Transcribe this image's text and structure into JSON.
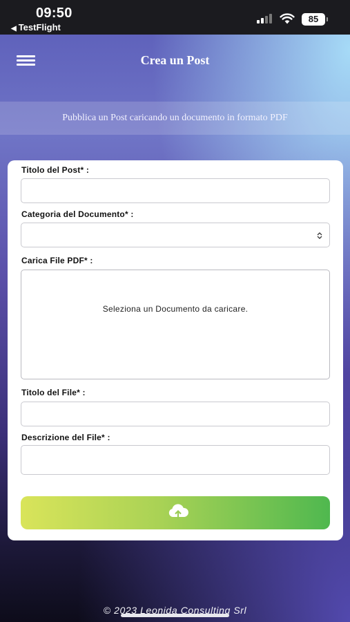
{
  "status_bar": {
    "time": "09:50",
    "back_app": "TestFlight",
    "battery": "85"
  },
  "header": {
    "title": "Crea un Post",
    "subtitle": "Pubblica un Post caricando un documento in formato PDF"
  },
  "form": {
    "post_title_label": "Titolo del Post* :",
    "post_title_value": "",
    "category_label": "Categoria del Documento* :",
    "category_value": "",
    "pdf_label": "Carica File PDF* :",
    "pdf_dropzone_text": "Seleziona un Documento da caricare.",
    "file_title_label": "Titolo del File* :",
    "file_title_value": "",
    "file_description_label": "Descrizione del File* :",
    "file_description_value": ""
  },
  "upload_button": {
    "icon": "cloud-upload-icon",
    "colors": [
      "#d9e45a",
      "#4fb84f"
    ]
  },
  "footer": {
    "copyright": "© 2023 Leonida Consulting Srl"
  }
}
